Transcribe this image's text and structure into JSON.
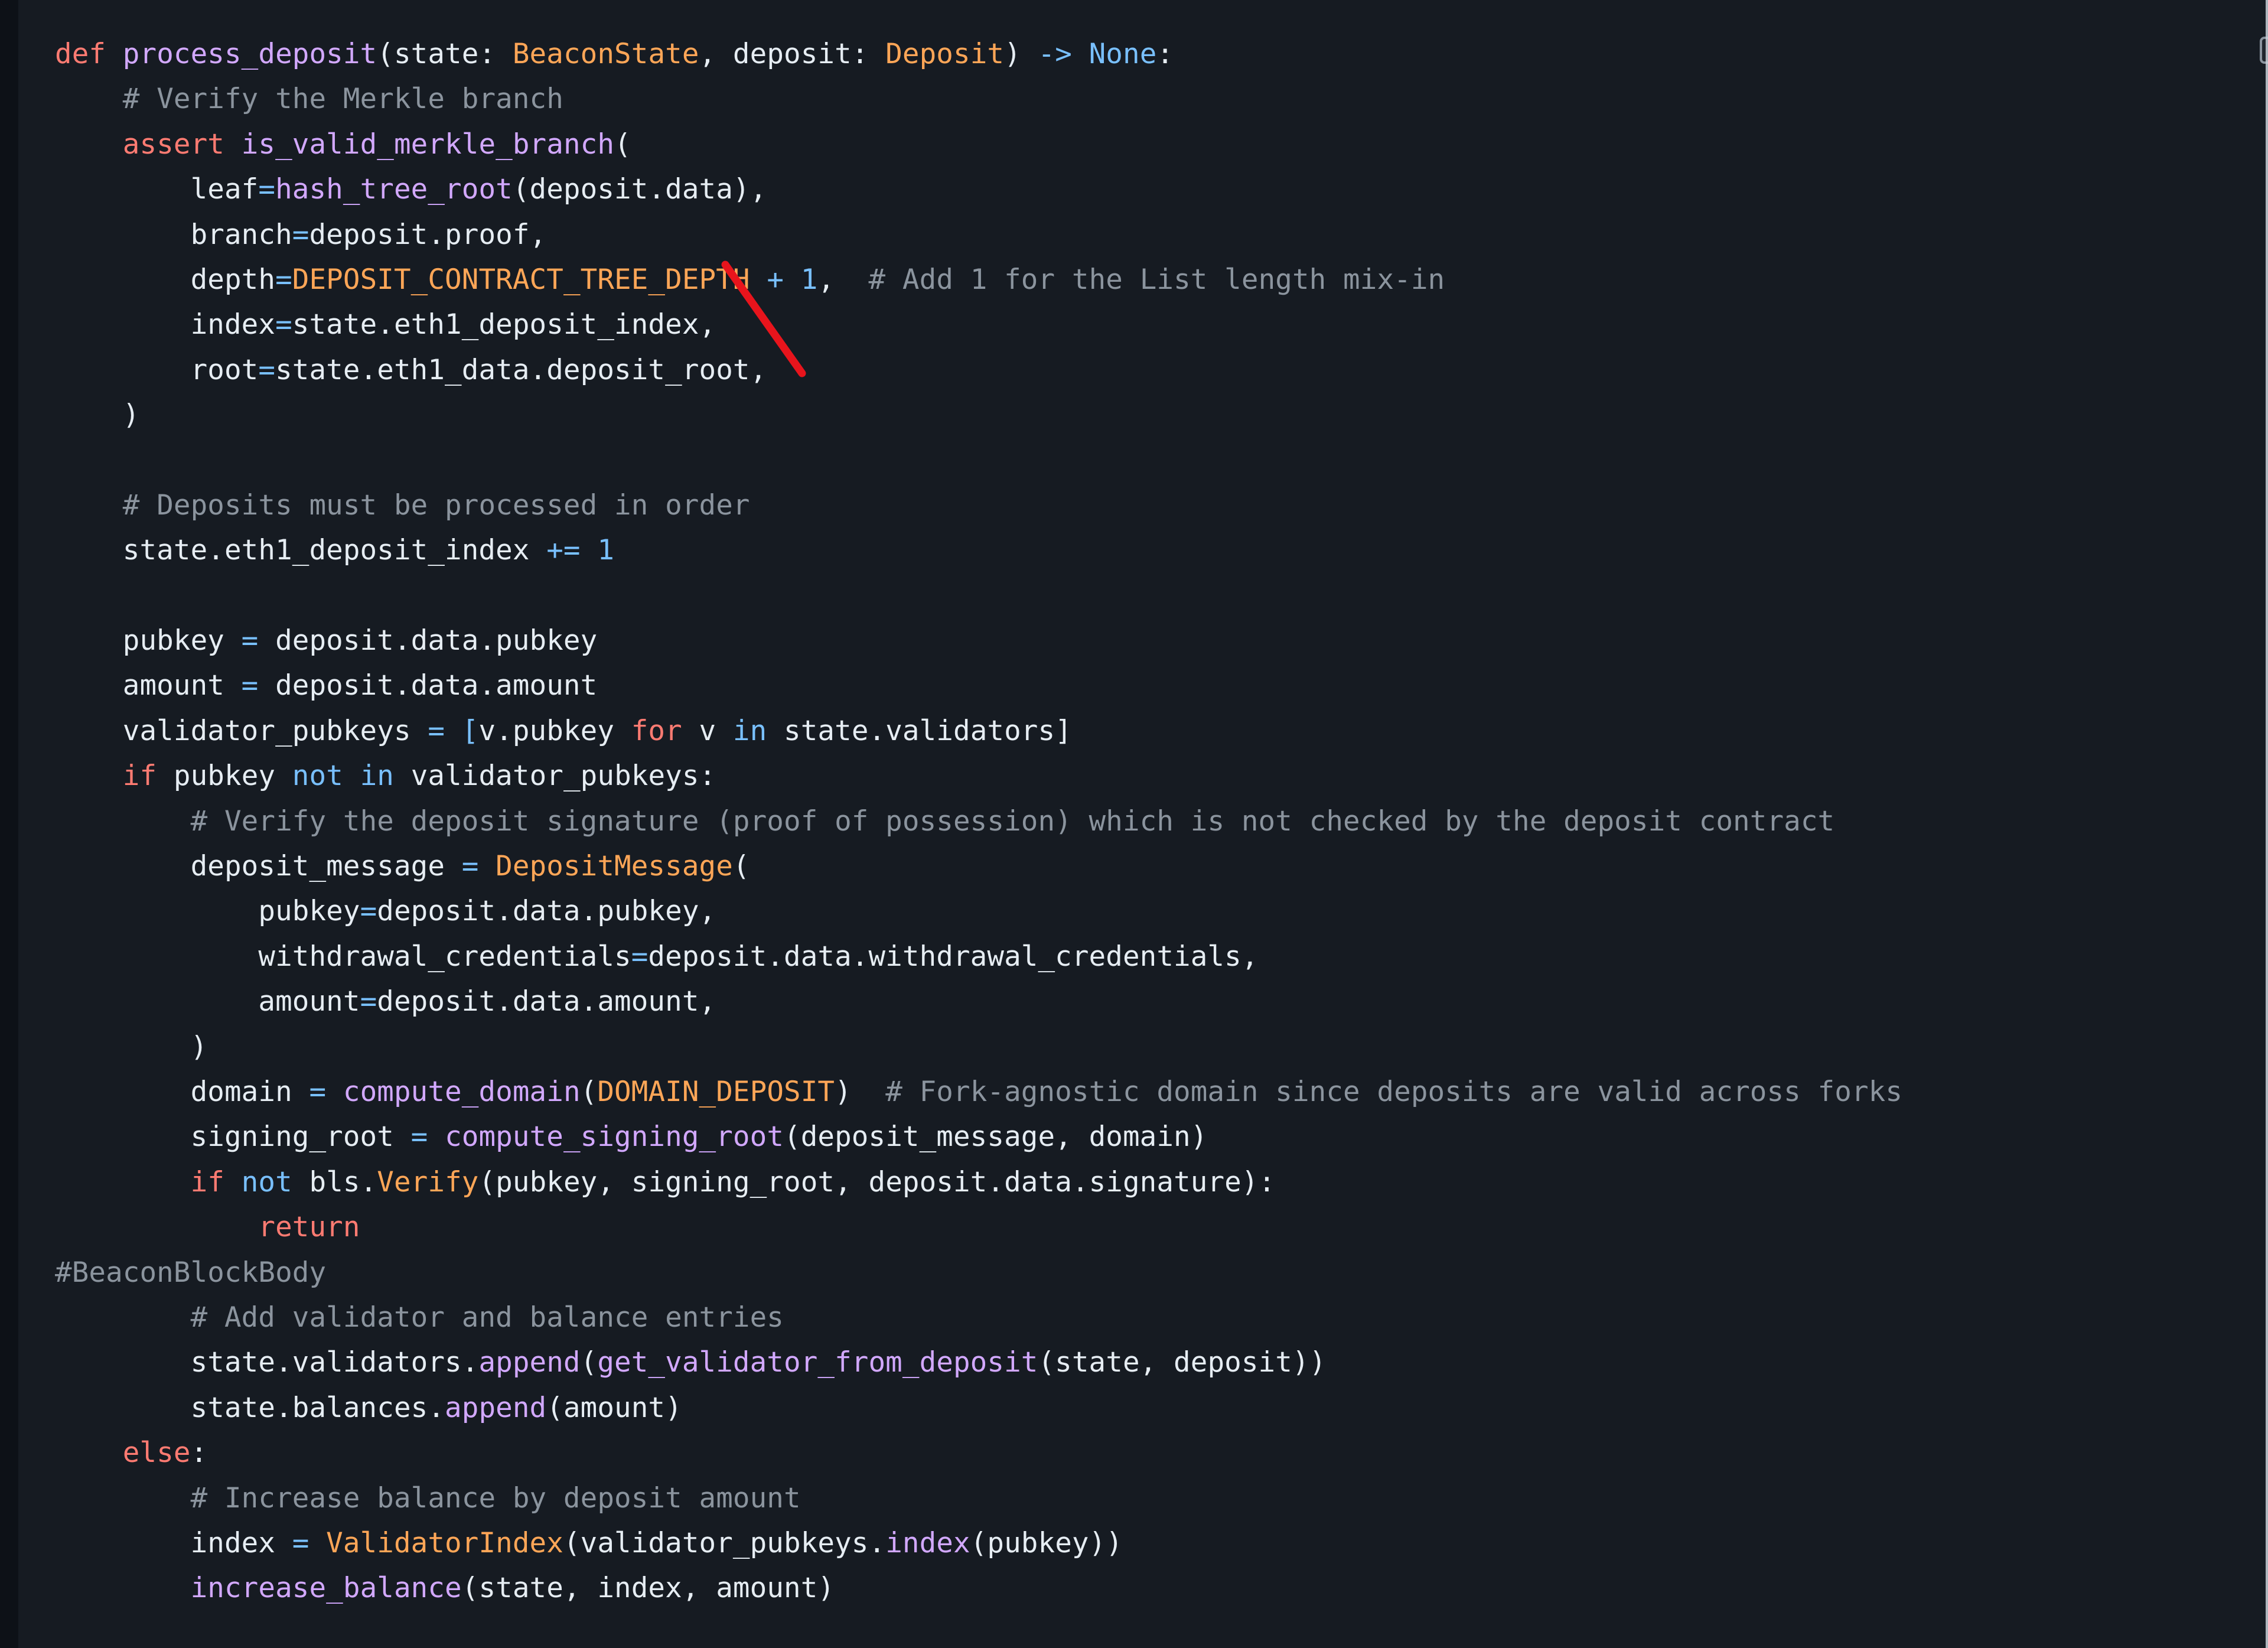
{
  "theme": {
    "background": "#161b22",
    "gutter_background": "#0d1117",
    "text": "#e6edf3",
    "keyword": "#ff7b72",
    "function": "#d2a8ff",
    "class": "#ffa657",
    "constant": "#79c0ff",
    "comment": "#8b949e",
    "annotation_stroke": "#e8141c"
  },
  "copy_button": {
    "label": "Copy"
  },
  "code": {
    "language": "python",
    "lines": [
      [
        [
          "kw",
          "def"
        ],
        [
          "tx",
          " "
        ],
        [
          "fn",
          "process_deposit"
        ],
        [
          "tx",
          "(state: "
        ],
        [
          "cls",
          "BeaconState"
        ],
        [
          "tx",
          ", deposit: "
        ],
        [
          "cls",
          "Deposit"
        ],
        [
          "tx",
          ") "
        ],
        [
          "op",
          "->"
        ],
        [
          "tx",
          " "
        ],
        [
          "con",
          "None"
        ],
        [
          "tx",
          ":"
        ]
      ],
      [
        [
          "tx",
          "    "
        ],
        [
          "cm",
          "# Verify the Merkle branch"
        ]
      ],
      [
        [
          "tx",
          "    "
        ],
        [
          "kw",
          "assert"
        ],
        [
          "tx",
          " "
        ],
        [
          "fn",
          "is_valid_merkle_branch"
        ],
        [
          "tx",
          "("
        ]
      ],
      [
        [
          "tx",
          "        leaf"
        ],
        [
          "op",
          "="
        ],
        [
          "fn",
          "hash_tree_root"
        ],
        [
          "tx",
          "(deposit.data),"
        ]
      ],
      [
        [
          "tx",
          "        branch"
        ],
        [
          "op",
          "="
        ],
        [
          "tx",
          "deposit.proof,"
        ]
      ],
      [
        [
          "tx",
          "        depth"
        ],
        [
          "op",
          "="
        ],
        [
          "cls",
          "DEPOSIT_CONTRACT_TREE_DEPTH"
        ],
        [
          "tx",
          " "
        ],
        [
          "op",
          "+"
        ],
        [
          "tx",
          " "
        ],
        [
          "con",
          "1"
        ],
        [
          "tx",
          ",  "
        ],
        [
          "cm",
          "# Add 1 for the List length mix-in"
        ]
      ],
      [
        [
          "tx",
          "        index"
        ],
        [
          "op",
          "="
        ],
        [
          "tx",
          "state.eth1_deposit_index,"
        ]
      ],
      [
        [
          "tx",
          "        root"
        ],
        [
          "op",
          "="
        ],
        [
          "tx",
          "state.eth1_data.deposit_root,"
        ]
      ],
      [
        [
          "tx",
          "    )"
        ]
      ],
      [
        [
          "tx",
          ""
        ]
      ],
      [
        [
          "tx",
          "    "
        ],
        [
          "cm",
          "# Deposits must be processed in order"
        ]
      ],
      [
        [
          "tx",
          "    state.eth1_deposit_index "
        ],
        [
          "op",
          "+="
        ],
        [
          "tx",
          " "
        ],
        [
          "con",
          "1"
        ]
      ],
      [
        [
          "tx",
          ""
        ]
      ],
      [
        [
          "tx",
          "    pubkey "
        ],
        [
          "op",
          "="
        ],
        [
          "tx",
          " deposit.data.pubkey"
        ]
      ],
      [
        [
          "tx",
          "    amount "
        ],
        [
          "op",
          "="
        ],
        [
          "tx",
          " deposit.data.amount"
        ]
      ],
      [
        [
          "tx",
          "    validator_pubkeys "
        ],
        [
          "op",
          "="
        ],
        [
          "tx",
          " "
        ],
        [
          "op",
          "["
        ],
        [
          "tx",
          "v.pubkey "
        ],
        [
          "kw",
          "for"
        ],
        [
          "tx",
          " v "
        ],
        [
          "con",
          "in"
        ],
        [
          "tx",
          " state.validators]"
        ]
      ],
      [
        [
          "tx",
          "    "
        ],
        [
          "kw",
          "if"
        ],
        [
          "tx",
          " pubkey "
        ],
        [
          "con",
          "not"
        ],
        [
          "tx",
          " "
        ],
        [
          "con",
          "in"
        ],
        [
          "tx",
          " validator_pubkeys:"
        ]
      ],
      [
        [
          "tx",
          "        "
        ],
        [
          "cm",
          "# Verify the deposit signature (proof of possession) which is not checked by the deposit contract"
        ]
      ],
      [
        [
          "tx",
          "        deposit_message "
        ],
        [
          "op",
          "="
        ],
        [
          "tx",
          " "
        ],
        [
          "cls",
          "DepositMessage"
        ],
        [
          "tx",
          "("
        ]
      ],
      [
        [
          "tx",
          "            pubkey"
        ],
        [
          "op",
          "="
        ],
        [
          "tx",
          "deposit.data.pubkey,"
        ]
      ],
      [
        [
          "tx",
          "            withdrawal_credentials"
        ],
        [
          "op",
          "="
        ],
        [
          "tx",
          "deposit.data.withdrawal_credentials,"
        ]
      ],
      [
        [
          "tx",
          "            amount"
        ],
        [
          "op",
          "="
        ],
        [
          "tx",
          "deposit.data.amount,"
        ]
      ],
      [
        [
          "tx",
          "        )"
        ]
      ],
      [
        [
          "tx",
          "        domain "
        ],
        [
          "op",
          "="
        ],
        [
          "tx",
          " "
        ],
        [
          "fn",
          "compute_domain"
        ],
        [
          "tx",
          "("
        ],
        [
          "cls",
          "DOMAIN_DEPOSIT"
        ],
        [
          "tx",
          ")  "
        ],
        [
          "cm",
          "# Fork-agnostic domain since deposits are valid across forks"
        ]
      ],
      [
        [
          "tx",
          "        signing_root "
        ],
        [
          "op",
          "="
        ],
        [
          "tx",
          " "
        ],
        [
          "fn",
          "compute_signing_root"
        ],
        [
          "tx",
          "(deposit_message, domain)"
        ]
      ],
      [
        [
          "tx",
          "        "
        ],
        [
          "kw",
          "if"
        ],
        [
          "tx",
          " "
        ],
        [
          "con",
          "not"
        ],
        [
          "tx",
          " bls."
        ],
        [
          "cls",
          "Verify"
        ],
        [
          "tx",
          "(pubkey, signing_root, deposit.data.signature):"
        ]
      ],
      [
        [
          "tx",
          "            "
        ],
        [
          "kw",
          "return"
        ]
      ],
      [
        [
          "cm",
          "#BeaconBlockBody"
        ]
      ],
      [
        [
          "tx",
          "        "
        ],
        [
          "cm",
          "# Add validator and balance entries"
        ]
      ],
      [
        [
          "tx",
          "        state.validators."
        ],
        [
          "fn",
          "append"
        ],
        [
          "tx",
          "("
        ],
        [
          "fn",
          "get_validator_from_deposit"
        ],
        [
          "tx",
          "(state, deposit))"
        ]
      ],
      [
        [
          "tx",
          "        state.balances."
        ],
        [
          "fn",
          "append"
        ],
        [
          "tx",
          "(amount)"
        ]
      ],
      [
        [
          "tx",
          "    "
        ],
        [
          "kw",
          "else"
        ],
        [
          "tx",
          ":"
        ]
      ],
      [
        [
          "tx",
          "        "
        ],
        [
          "cm",
          "# Increase balance by deposit amount"
        ]
      ],
      [
        [
          "tx",
          "        index "
        ],
        [
          "op",
          "="
        ],
        [
          "tx",
          " "
        ],
        [
          "cls",
          "ValidatorIndex"
        ],
        [
          "tx",
          "(validator_pubkeys."
        ],
        [
          "fn",
          "index"
        ],
        [
          "tx",
          "(pubkey))"
        ]
      ],
      [
        [
          "tx",
          "        "
        ],
        [
          "fn",
          "increase_balance"
        ],
        [
          "tx",
          "(state, index, amount)"
        ]
      ]
    ]
  }
}
